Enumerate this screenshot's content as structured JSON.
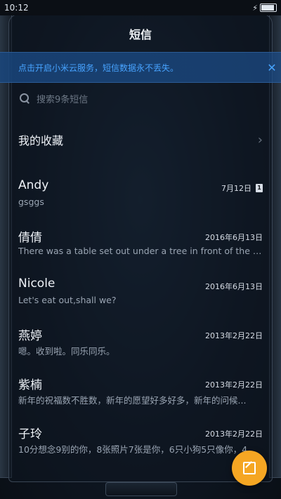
{
  "status": {
    "time": "10:12"
  },
  "header": {
    "title": "短信"
  },
  "banner": {
    "text": "点击开启小米云服务，短信数据永不丢失。",
    "close": "✕"
  },
  "search": {
    "placeholder": "搜索9条短信"
  },
  "favorites": {
    "label": "我的收藏"
  },
  "conversations": [
    {
      "name": "Andy",
      "date": "7月12日",
      "sim": "1",
      "preview": "gsggs"
    },
    {
      "name": "倩倩",
      "date": "2016年6月13日",
      "preview": "There was a table set out under a tree in front of the ho..."
    },
    {
      "name": "Nicole",
      "date": "2016年6月13日",
      "preview": "Let's eat out,shall we?"
    },
    {
      "name": "燕婷",
      "date": "2013年2月22日",
      "preview": "嗯。收到啦。同乐同乐。"
    },
    {
      "name": "紫楠",
      "date": "2013年2月22日",
      "preview": "新年的祝福数不胜数，新年的愿望好多好多，新年的问候..."
    },
    {
      "name": "子玲",
      "date": "2013年2月22日",
      "preview": "10分想念9别的你，8张照片7张是你，6只小狗5只像你，4..."
    }
  ],
  "icons": {
    "search": "search-icon",
    "close": "close-icon",
    "chevron": "chevron-right-icon",
    "compose": "compose-icon"
  },
  "colors": {
    "accent": "#f5a623",
    "banner_text": "#47a3ff"
  }
}
